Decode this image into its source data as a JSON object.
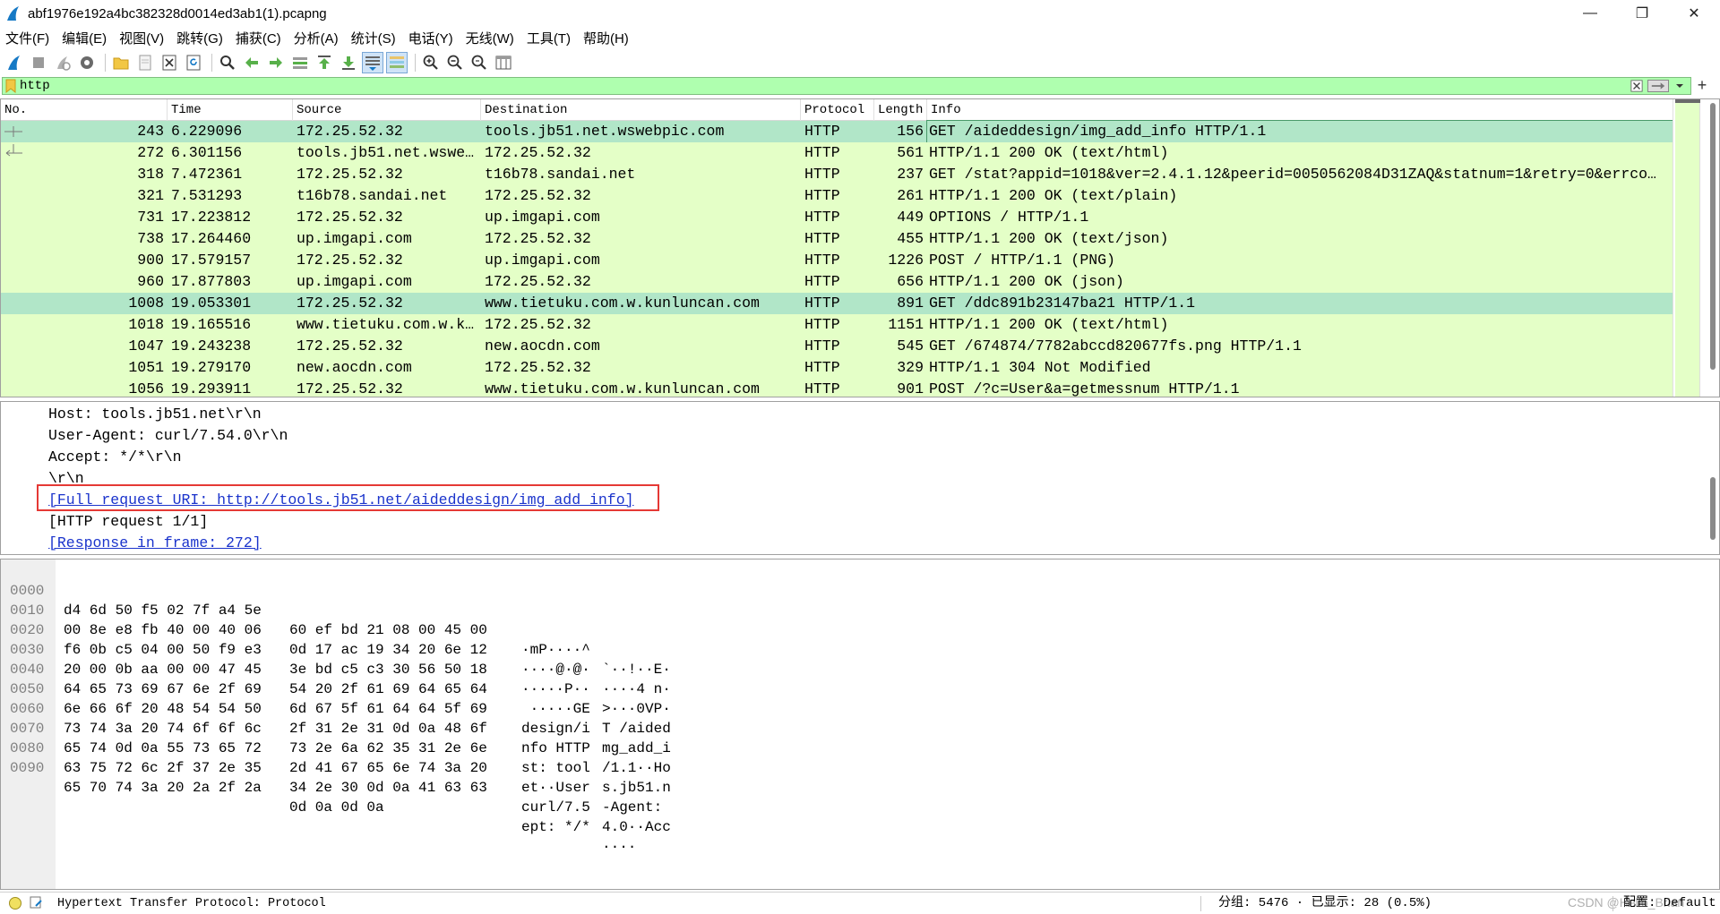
{
  "window": {
    "title": "abf1976e192a4bc382328d0014ed3ab1(1).pcapng",
    "minimize": "—",
    "restore": "❐",
    "close": "✕"
  },
  "menu": [
    "文件(F)",
    "编辑(E)",
    "视图(V)",
    "跳转(G)",
    "捕获(C)",
    "分析(A)",
    "统计(S)",
    "电话(Y)",
    "无线(W)",
    "工具(T)",
    "帮助(H)"
  ],
  "filter": {
    "value": "http"
  },
  "packet_list": {
    "columns": [
      "No.",
      "Time",
      "Source",
      "Destination",
      "Protocol",
      "Length",
      "Info"
    ],
    "rows": [
      {
        "no": "243",
        "time": "6.229096",
        "src": "172.25.52.32",
        "dst": "tools.jb51.net.wswebpic.com",
        "proto": "HTTP",
        "len": "156",
        "info": "GET /aideddesign/img_add_info HTTP/1.1"
      },
      {
        "no": "272",
        "time": "6.301156",
        "src": "tools.jb51.net.wswe…",
        "dst": "172.25.52.32",
        "proto": "HTTP",
        "len": "561",
        "info": "HTTP/1.1 200 OK  (text/html)"
      },
      {
        "no": "318",
        "time": "7.472361",
        "src": "172.25.52.32",
        "dst": "t16b78.sandai.net",
        "proto": "HTTP",
        "len": "237",
        "info": "GET /stat?appid=1018&ver=2.4.1.12&peerid=0050562084D31ZAQ&statnum=1&retry=0&errco…"
      },
      {
        "no": "321",
        "time": "7.531293",
        "src": "t16b78.sandai.net",
        "dst": "172.25.52.32",
        "proto": "HTTP",
        "len": "261",
        "info": "HTTP/1.1 200 OK  (text/plain)"
      },
      {
        "no": "731",
        "time": "17.223812",
        "src": "172.25.52.32",
        "dst": "up.imgapi.com",
        "proto": "HTTP",
        "len": "449",
        "info": "OPTIONS / HTTP/1.1"
      },
      {
        "no": "738",
        "time": "17.264460",
        "src": "up.imgapi.com",
        "dst": "172.25.52.32",
        "proto": "HTTP",
        "len": "455",
        "info": "HTTP/1.1 200 OK  (text/json)"
      },
      {
        "no": "900",
        "time": "17.579157",
        "src": "172.25.52.32",
        "dst": "up.imgapi.com",
        "proto": "HTTP",
        "len": "1226",
        "info": "POST / HTTP/1.1  (PNG)"
      },
      {
        "no": "960",
        "time": "17.877803",
        "src": "up.imgapi.com",
        "dst": "172.25.52.32",
        "proto": "HTTP",
        "len": "656",
        "info": "HTTP/1.1 200 OK  (json)"
      },
      {
        "no": "1008",
        "time": "19.053301",
        "src": "172.25.52.32",
        "dst": "www.tietuku.com.w.kunluncan.com",
        "proto": "HTTP",
        "len": "891",
        "info": "GET /ddc891b23147ba21 HTTP/1.1"
      },
      {
        "no": "1018",
        "time": "19.165516",
        "src": "www.tietuku.com.w.k…",
        "dst": "172.25.52.32",
        "proto": "HTTP",
        "len": "1151",
        "info": "HTTP/1.1 200 OK  (text/html)"
      },
      {
        "no": "1047",
        "time": "19.243238",
        "src": "172.25.52.32",
        "dst": "new.aocdn.com",
        "proto": "HTTP",
        "len": "545",
        "info": "GET /674874/7782abccd820677fs.png HTTP/1.1"
      },
      {
        "no": "1051",
        "time": "19.279170",
        "src": "new.aocdn.com",
        "dst": "172.25.52.32",
        "proto": "HTTP",
        "len": "329",
        "info": "HTTP/1.1 304 Not Modified"
      },
      {
        "no": "1056",
        "time": "19.293911",
        "src": "172.25.52.32",
        "dst": "www.tietuku.com.w.kunluncan.com",
        "proto": "HTTP",
        "len": "901",
        "info": "POST /?c=User&a=getmessnum HTTP/1.1"
      }
    ]
  },
  "details": {
    "lines": [
      "Host: tools.jb51.net\\r\\n",
      "User-Agent: curl/7.54.0\\r\\n",
      "Accept: */*\\r\\n",
      "\\r\\n"
    ],
    "full_uri": "[Full request URI: http://tools.jb51.net/aideddesign/img_add_info]",
    "http_request": "[HTTP request 1/1]",
    "response_in": "[Response in frame: 272]"
  },
  "bytes": [
    {
      "off": "0000",
      "h1": "d4 6d 50 f5 02 7f a4 5e",
      "h2": "60 ef bd 21 08 00 45 00",
      "a1": "·mP····^",
      "a2": "`··!··E·"
    },
    {
      "off": "0010",
      "h1": "00 8e e8 fb 40 00 40 06",
      "h2": "0d 17 ac 19 34 20 6e 12",
      "a1": "····@·@·",
      "a2": "····4 n·"
    },
    {
      "off": "0020",
      "h1": "f6 0b c5 04 00 50 f9 e3",
      "h2": "3e bd c5 c3 30 56 50 18",
      "a1": "·····P··",
      "a2": ">···0VP·"
    },
    {
      "off": "0030",
      "h1": "20 00 0b aa 00 00 47 45",
      "h2": "54 20 2f 61 69 64 65 64",
      "a1": " ·····GE",
      "a2": "T /aided"
    },
    {
      "off": "0040",
      "h1": "64 65 73 69 67 6e 2f 69",
      "h2": "6d 67 5f 61 64 64 5f 69",
      "a1": "design/i",
      "a2": "mg_add_i"
    },
    {
      "off": "0050",
      "h1": "6e 66 6f 20 48 54 54 50",
      "h2": "2f 31 2e 31 0d 0a 48 6f",
      "a1": "nfo HTTP",
      "a2": "/1.1··Ho"
    },
    {
      "off": "0060",
      "h1": "73 74 3a 20 74 6f 6f 6c",
      "h2": "73 2e 6a 62 35 31 2e 6e",
      "a1": "st: tool",
      "a2": "s.jb51.n"
    },
    {
      "off": "0070",
      "h1": "65 74 0d 0a 55 73 65 72",
      "h2": "2d 41 67 65 6e 74 3a 20",
      "a1": "et··User",
      "a2": "-Agent: "
    },
    {
      "off": "0080",
      "h1": "63 75 72 6c 2f 37 2e 35",
      "h2": "34 2e 30 0d 0a 41 63 63",
      "a1": "curl/7.5",
      "a2": "4.0··Acc"
    },
    {
      "off": "0090",
      "h1": "65 70 74 3a 20 2a 2f 2a",
      "h2": "0d 0a 0d 0a",
      "a1": "ept: */*",
      "a2": "····"
    }
  ],
  "status": {
    "protocol": "Hypertext Transfer Protocol: Protocol",
    "stats": "分组: 5476 · 已显示: 28 (0.5%)",
    "profile": "配置: Default",
    "watermark": "CSDN @Hello_Brian"
  },
  "colors": {
    "row_bg": "#e4ffc7",
    "selected_row": "#b1e6c8",
    "filter_bg": "#afffaf",
    "highlight_box": "#e53935",
    "link": "#1a33cc"
  }
}
